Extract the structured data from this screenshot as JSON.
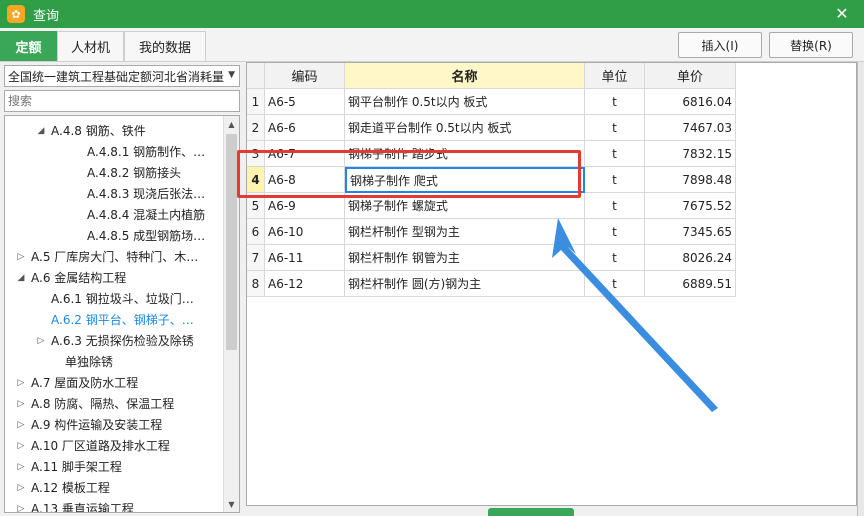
{
  "window": {
    "title": "查询",
    "icon": "app-logo-icon",
    "close_icon": "close-icon",
    "close_glyph": "✕"
  },
  "tabs": [
    {
      "label": "定额",
      "active": true
    },
    {
      "label": "人材机",
      "active": false
    },
    {
      "label": "我的数据",
      "active": false
    }
  ],
  "actions": {
    "insert_label": "插入(I)",
    "replace_label": "替换(R)"
  },
  "left": {
    "library": "全国统一建筑工程基础定额河北省消耗量",
    "search_placeholder": "搜索",
    "tree": [
      {
        "label": "A.4.8 钢筋、铁件",
        "level": 2,
        "expanded": true,
        "has_children": true
      },
      {
        "label": "A.4.8.1 钢筋制作、…",
        "level": 3,
        "has_children": false
      },
      {
        "label": "A.4.8.2 钢筋接头",
        "level": 3,
        "has_children": false
      },
      {
        "label": "A.4.8.3 现浇后张法…",
        "level": 3,
        "has_children": false
      },
      {
        "label": "A.4.8.4 混凝土内植筋",
        "level": 3,
        "has_children": false
      },
      {
        "label": "A.4.8.5 成型钢筋场…",
        "level": 3,
        "has_children": false
      },
      {
        "label": "A.5 厂库房大门、特种门、木…",
        "level": 1,
        "expanded": false,
        "has_children": true
      },
      {
        "label": "A.6 金属结构工程",
        "level": 1,
        "expanded": true,
        "has_children": true
      },
      {
        "label": "A.6.1 钢拉圾斗、垃圾门…",
        "level": 2,
        "has_children": false
      },
      {
        "label": "A.6.2 钢平台、钢梯子、…",
        "level": 2,
        "has_children": false,
        "selected": true
      },
      {
        "label": "A.6.3 无损探伤检验及除锈",
        "level": 2,
        "expanded": false,
        "has_children": true
      },
      {
        "label": "单独除锈",
        "level": 2,
        "has_children": false,
        "continuation": true
      },
      {
        "label": "A.7 屋面及防水工程",
        "level": 1,
        "expanded": false,
        "has_children": true
      },
      {
        "label": "A.8 防腐、隔热、保温工程",
        "level": 1,
        "expanded": false,
        "has_children": true
      },
      {
        "label": "A.9 构件运输及安装工程",
        "level": 1,
        "expanded": false,
        "has_children": true
      },
      {
        "label": "A.10 厂区道路及排水工程",
        "level": 1,
        "expanded": false,
        "has_children": true
      },
      {
        "label": "A.11 脚手架工程",
        "level": 1,
        "expanded": false,
        "has_children": true
      },
      {
        "label": "A.12 模板工程",
        "level": 1,
        "expanded": false,
        "has_children": true
      },
      {
        "label": "A.13 垂直运输工程",
        "level": 1,
        "expanded": false,
        "has_children": true
      }
    ]
  },
  "table": {
    "headers": {
      "code": "编码",
      "name": "名称",
      "unit": "单位",
      "price": "单价"
    },
    "rows": [
      {
        "idx": "1",
        "code": "A6-5",
        "name": "钢平台制作 0.5t以内 板式",
        "unit": "t",
        "price": "6816.04"
      },
      {
        "idx": "2",
        "code": "A6-6",
        "name": "钢走道平台制作 0.5t以内 板式",
        "unit": "t",
        "price": "7467.03"
      },
      {
        "idx": "3",
        "code": "A6-7",
        "name": "钢梯子制作 踏步式",
        "unit": "t",
        "price": "7832.15"
      },
      {
        "idx": "4",
        "code": "A6-8",
        "name": "钢梯子制作 爬式",
        "unit": "t",
        "price": "7898.48",
        "current": true
      },
      {
        "idx": "5",
        "code": "A6-9",
        "name": "钢梯子制作 螺旋式",
        "unit": "t",
        "price": "7675.52"
      },
      {
        "idx": "6",
        "code": "A6-10",
        "name": "钢栏杆制作 型钢为主",
        "unit": "t",
        "price": "7345.65"
      },
      {
        "idx": "7",
        "code": "A6-11",
        "name": "钢栏杆制作 钢管为主",
        "unit": "t",
        "price": "8026.24"
      },
      {
        "idx": "8",
        "code": "A6-12",
        "name": "钢栏杆制作 圆(方)钢为主",
        "unit": "t",
        "price": "6889.51"
      }
    ]
  },
  "annotation": {
    "box_color": "#e53935",
    "arrow_color": "#3b8de0"
  },
  "colors": {
    "titlebar": "#2f9e47",
    "active_tab": "#3aa657",
    "selected_tree": "#1e88e5"
  }
}
